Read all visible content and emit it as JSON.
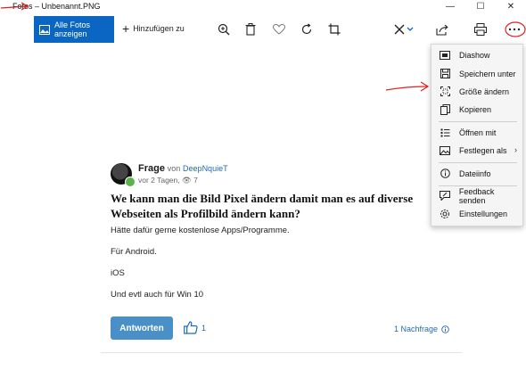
{
  "window": {
    "title": "Fotos – Unbenannt.PNG",
    "controls": [
      "minimize",
      "maximize",
      "close"
    ]
  },
  "toolbar": {
    "all_photos_label": "Alle Fotos anzeigen",
    "add_to_label": "Hinzufügen zu",
    "icons": [
      "zoom-icon",
      "trash-icon",
      "heart-icon",
      "rotate-icon",
      "crop-icon",
      "edit-icon",
      "share-icon",
      "print-icon",
      "more-icon"
    ]
  },
  "post": {
    "title_prefix": "Frage",
    "von": "von",
    "author": "DeepNquieT",
    "time_views": "vor 2 Tagen, 👁 7",
    "question": "We kann man die Bild Pixel ändern damit man es auf diverse Webseiten als Profilbild ändern kann?",
    "p1": "Hätte dafür gerne kostenlose Apps/Programme.",
    "p2": "Für Android.",
    "p3": "iOS",
    "p4": "Und evtl auch für Win 10",
    "answer_button": "Antworten",
    "likes": "1",
    "followup": "1 Nachfrage"
  },
  "menu": {
    "items": [
      {
        "label": "Diashow",
        "icon": "slideshow-icon"
      },
      {
        "label": "Speichern unter",
        "icon": "save-icon"
      },
      {
        "label": "Größe ändern",
        "icon": "resize-icon"
      },
      {
        "label": "Kopieren",
        "icon": "copy-icon"
      },
      {
        "label": "Öffnen mit",
        "icon": "open-with-icon"
      },
      {
        "label": "Festlegen als",
        "icon": "set-as-icon"
      },
      {
        "label": "Dateiinfo",
        "icon": "info-icon"
      },
      {
        "label": "Feedback senden",
        "icon": "feedback-icon"
      },
      {
        "label": "Einstellungen",
        "icon": "settings-icon"
      }
    ]
  },
  "colors": {
    "accent": "#0a66c2",
    "annotation": "#e02020",
    "link": "#1f6ab5",
    "answer_button": "#4a90c8"
  }
}
